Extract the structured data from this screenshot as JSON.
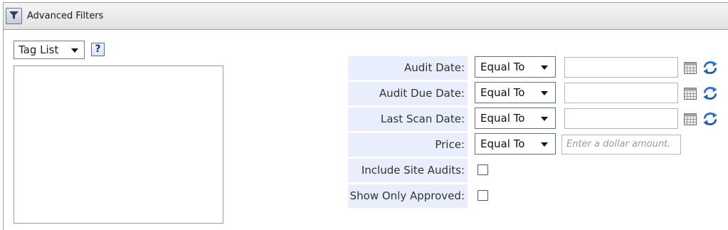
{
  "header": {
    "title": "Advanced Filters",
    "icon": "funnel-icon"
  },
  "tag_list": {
    "selected": "Tag List",
    "help_label": "?"
  },
  "filters": {
    "audit_date": {
      "label": "Audit Date:",
      "operator": "Equal To",
      "value": ""
    },
    "audit_due_date": {
      "label": "Audit Due Date:",
      "operator": "Equal To",
      "value": ""
    },
    "last_scan_date": {
      "label": "Last Scan Date:",
      "operator": "Equal To",
      "value": ""
    },
    "price": {
      "label": "Price:",
      "operator": "Equal To",
      "placeholder": "Enter a dollar amount."
    },
    "include_site_audits": {
      "label": "Include Site Audits:",
      "checked": false
    },
    "show_only_approved": {
      "label": "Show Only Approved:",
      "checked": false
    }
  },
  "colors": {
    "label_bg": "#e8eefb",
    "header_bg": "#e6e6e6",
    "refresh_blue": "#2a6fd0"
  }
}
